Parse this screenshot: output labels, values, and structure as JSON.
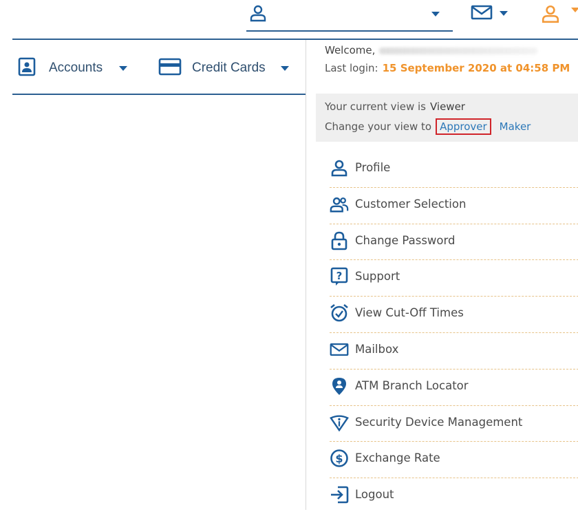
{
  "colors": {
    "primary": "#1c5d9c",
    "accent": "#f39a3a",
    "highlight_border": "#d0242a",
    "menu_separator": "#e7c389"
  },
  "topbar": {
    "user_icon": "user-icon",
    "mail_icon": "envelope-icon",
    "profile_icon": "user-icon"
  },
  "nav": {
    "accounts_label": "Accounts",
    "accounts_icon": "account-card-icon",
    "credit_cards_label": "Credit Cards",
    "credit_cards_icon": "credit-card-icon"
  },
  "profile_menu": {
    "welcome_label": "Welcome,",
    "last_login_label": "Last login:",
    "last_login_value": "15 September 2020 at 04:58 PM",
    "current_view_label": "Your current view is",
    "current_view_value": "Viewer",
    "change_view_label": "Change your view to",
    "view_options": [
      "Approver",
      "Maker"
    ],
    "items": [
      {
        "label": "Profile",
        "icon": "user-icon"
      },
      {
        "label": "Customer Selection",
        "icon": "users-icon"
      },
      {
        "label": "Change Password",
        "icon": "lock-icon"
      },
      {
        "label": "Support",
        "icon": "question-icon"
      },
      {
        "label": "View Cut-Off Times",
        "icon": "alarm-clock-icon"
      },
      {
        "label": "Mailbox",
        "icon": "envelope-icon"
      },
      {
        "label": "ATM Branch Locator",
        "icon": "location-pin-icon"
      },
      {
        "label": "Security Device Management",
        "icon": "shield-icon"
      },
      {
        "label": "Exchange Rate",
        "icon": "dollar-icon"
      },
      {
        "label": "Logout",
        "icon": "logout-icon"
      }
    ]
  }
}
